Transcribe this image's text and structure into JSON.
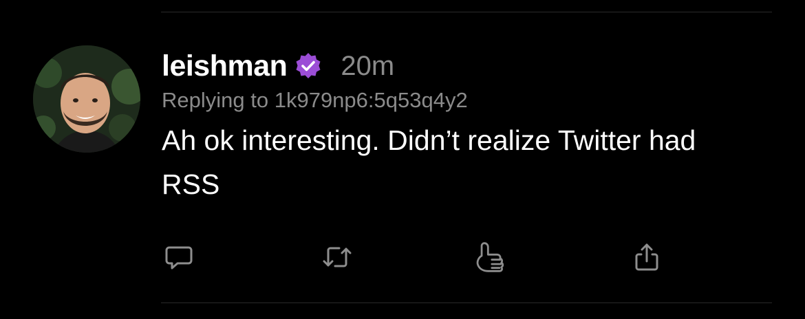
{
  "post": {
    "username": "leishman",
    "timestamp": "20m",
    "reply_prefix": "Replying to ",
    "reply_target": "1k979np6:5q53q4y2",
    "text": "Ah ok interesting. Didn’t realize Twitter had RSS"
  },
  "icons": {
    "verified": "verified-badge-icon",
    "reply": "reply-bubble-icon",
    "repost": "repost-icon",
    "like": "shaka-hand-icon",
    "share": "share-icon"
  },
  "colors": {
    "background": "#000000",
    "text_primary": "#ffffff",
    "text_secondary": "#8b8b8b",
    "verified_badge": "#9b4dd6",
    "divider": "#2a2a2a",
    "icon": "#8e8e8e"
  }
}
